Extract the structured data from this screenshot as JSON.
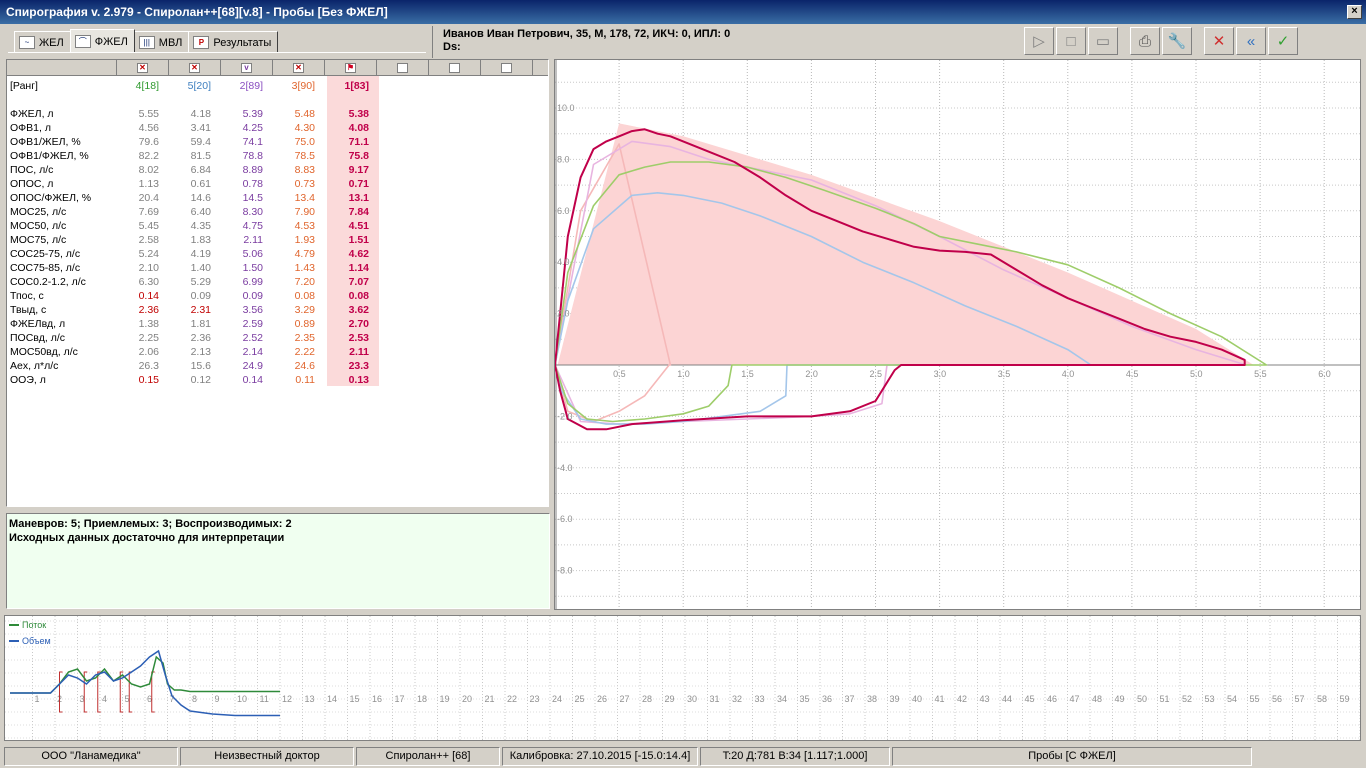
{
  "window": {
    "title": "Спирография v. 2.979 - Спиролан++[68][v.8] - Пробы [Без ФЖЕЛ]",
    "close": "×"
  },
  "tabs": [
    {
      "label": "ЖЕЛ",
      "icon": "vc-wave-icon"
    },
    {
      "label": "ФЖЕЛ",
      "icon": "fvc-curve-icon"
    },
    {
      "label": "МВЛ",
      "icon": "mvv-bars-icon"
    },
    {
      "label": "Результаты",
      "icon": "results-icon",
      "icon_text": "P"
    }
  ],
  "patient": {
    "line1": "Иванов Иван Петрович, 35, М, 178, 72, ИКЧ: 0, ИПЛ: 0",
    "line2": "Ds:"
  },
  "toolbar": {
    "buttons": [
      {
        "name": "play-icon",
        "glyph": "▷"
      },
      {
        "name": "stop-icon",
        "glyph": "□"
      },
      {
        "name": "minus-icon",
        "glyph": "▭"
      },
      {
        "name": "printer-icon",
        "glyph": "⎙"
      },
      {
        "name": "wrench-icon",
        "glyph": "🔧"
      },
      {
        "name": "delete-icon",
        "glyph": "✕"
      },
      {
        "name": "rewind-icon",
        "glyph": "«"
      },
      {
        "name": "accept-icon",
        "glyph": "✓"
      }
    ]
  },
  "table": {
    "rank_label": "[Ранг]",
    "columns": [
      {
        "rank": "4[18]",
        "color": "#2f9a2f"
      },
      {
        "rank": "5[20]",
        "color": "#3f7fbf"
      },
      {
        "rank": "2[89]",
        "color": "#8a4fc0"
      },
      {
        "rank": "3[90]",
        "color": "#e0652d"
      },
      {
        "rank": "1[83]",
        "color": "#c0004a"
      }
    ],
    "rows": [
      {
        "label": "ФЖЕЛ, л",
        "values": [
          "5.55",
          "4.18",
          "5.39",
          "5.48",
          "5.38"
        ]
      },
      {
        "label": "ОФВ1, л",
        "values": [
          "4.56",
          "3.41",
          "4.25",
          "4.30",
          "4.08"
        ]
      },
      {
        "label": "ОФВ1/ЖЕЛ, %",
        "values": [
          "79.6",
          "59.4",
          "74.1",
          "75.0",
          "71.1"
        ]
      },
      {
        "label": "ОФВ1/ФЖЕЛ, %",
        "values": [
          "82.2",
          "81.5",
          "78.8",
          "78.5",
          "75.8"
        ]
      },
      {
        "label": "ПОС, л/с",
        "values": [
          "8.02",
          "6.84",
          "8.89",
          "8.83",
          "9.17"
        ]
      },
      {
        "label": "ОПОС, л",
        "values": [
          "1.13",
          "0.61",
          "0.78",
          "0.73",
          "0.71"
        ]
      },
      {
        "label": "ОПОС/ФЖЕЛ, %",
        "values": [
          "20.4",
          "14.6",
          "14.5",
          "13.4",
          "13.1"
        ]
      },
      {
        "label": "МОС25, л/с",
        "values": [
          "7.69",
          "6.40",
          "8.30",
          "7.90",
          "7.84"
        ]
      },
      {
        "label": "МОС50, л/с",
        "values": [
          "5.45",
          "4.35",
          "4.75",
          "4.53",
          "4.51"
        ]
      },
      {
        "label": "МОС75, л/с",
        "values": [
          "2.58",
          "1.83",
          "2.11",
          "1.93",
          "1.51"
        ]
      },
      {
        "label": "СОС25-75, л/с",
        "values": [
          "5.24",
          "4.19",
          "5.06",
          "4.79",
          "4.62"
        ]
      },
      {
        "label": "СОС75-85, л/с",
        "values": [
          "2.10",
          "1.40",
          "1.50",
          "1.43",
          "1.14"
        ]
      },
      {
        "label": "СОС0.2-1.2, л/с",
        "values": [
          "6.30",
          "5.29",
          "6.99",
          "7.20",
          "7.07"
        ]
      },
      {
        "label": "Тпос, с",
        "values": [
          "0.14",
          "0.09",
          "0.09",
          "0.08",
          "0.08"
        ],
        "warn": [
          true,
          false,
          false,
          false,
          false
        ]
      },
      {
        "label": "Твыд, с",
        "values": [
          "2.36",
          "2.31",
          "3.56",
          "3.29",
          "3.62"
        ],
        "warn": [
          true,
          true,
          false,
          false,
          false
        ]
      },
      {
        "label": "ФЖЕЛвд, л",
        "values": [
          "1.38",
          "1.81",
          "2.59",
          "0.89",
          "2.70"
        ]
      },
      {
        "label": "ПОСвд, л/с",
        "values": [
          "2.25",
          "2.36",
          "2.52",
          "2.35",
          "2.53"
        ]
      },
      {
        "label": "МОС50вд, л/с",
        "values": [
          "2.06",
          "2.13",
          "2.14",
          "2.22",
          "2.11"
        ]
      },
      {
        "label": "Aex, л*л/с",
        "values": [
          "26.3",
          "15.6",
          "24.9",
          "24.6",
          "23.3"
        ]
      },
      {
        "label": "ООЭ, л",
        "values": [
          "0.15",
          "0.12",
          "0.14",
          "0.11",
          "0.13"
        ],
        "warn": [
          true,
          false,
          false,
          false,
          false
        ]
      }
    ]
  },
  "remarks": {
    "line1": "Маневров: 5; Приемлемых: 3; Воспроизводимых: 2",
    "line2": "Исходных данных достаточно для интерпретации"
  },
  "chart_data": [
    {
      "type": "line",
      "title": "",
      "xlabel": "",
      "ylabel": "",
      "xlim": [
        0,
        6.0
      ],
      "ylim": [
        -8.0,
        10.0
      ],
      "x_ticks": [
        "0.5",
        "1.0",
        "1.5",
        "2.0",
        "2.5",
        "3.0",
        "3.5",
        "4.0",
        "4.5",
        "5.0",
        "5.5",
        "6.0"
      ],
      "y_ticks": [
        "10.0",
        "8.0",
        "6.0",
        "4.0",
        "2.0",
        "-2.0",
        "-4.0",
        "-6.0",
        "-8.0"
      ],
      "predicted_area": {
        "color": "#fcd4d4",
        "x": [
          0.02,
          0.5,
          0.7,
          1.0,
          2.0,
          3.0,
          4.0,
          5.0,
          5.45
        ],
        "y": [
          0,
          9.4,
          9.2,
          8.9,
          7.4,
          5.6,
          3.6,
          1.4,
          0
        ]
      },
      "series": [
        {
          "color": "#c0004a",
          "x": [
            0,
            0.05,
            0.1,
            0.2,
            0.3,
            0.4,
            0.5,
            0.6,
            0.7,
            0.8,
            0.9,
            1.0,
            1.2,
            1.4,
            1.6,
            1.8,
            2.0,
            2.2,
            2.4,
            2.6,
            2.8,
            3.0,
            3.2,
            3.4,
            3.6,
            3.8,
            4.0,
            4.2,
            4.4,
            4.6,
            4.8,
            5.0,
            5.2,
            5.38,
            5.38,
            5.2,
            5.0,
            4.6,
            4.0,
            3.5,
            3.0,
            2.7,
            2.65,
            2.5,
            2.3,
            2.0,
            1.5,
            1.0,
            0.6,
            0.4,
            0.25,
            0.1,
            0.04,
            0
          ],
          "y": [
            0,
            2.5,
            5.0,
            7.3,
            8.4,
            8.7,
            8.9,
            9.1,
            9.17,
            9.0,
            8.9,
            8.7,
            8.3,
            7.9,
            7.3,
            6.6,
            6.0,
            5.6,
            5.2,
            4.9,
            4.6,
            4.45,
            4.4,
            4.3,
            3.7,
            3.1,
            2.6,
            2.2,
            1.8,
            1.4,
            1.1,
            0.9,
            0.6,
            0.2,
            0,
            0,
            0,
            0,
            0,
            0,
            0,
            0,
            -0.2,
            -1.4,
            -1.8,
            -2.0,
            -2.0,
            -2.15,
            -2.3,
            -2.5,
            -2.5,
            -2.1,
            -1.0,
            0
          ]
        },
        {
          "color": "#9ecd6a",
          "x": [
            0,
            0.1,
            0.3,
            0.5,
            0.7,
            0.9,
            1.2,
            1.5,
            1.8,
            2.1,
            2.5,
            2.8,
            3.0,
            3.3,
            3.6,
            4.0,
            4.4,
            4.8,
            5.2,
            5.55,
            5.55,
            1.38,
            1.35,
            1.2,
            1.0,
            0.7,
            0.45,
            0.25,
            0.1,
            0
          ],
          "y": [
            0,
            3.6,
            6.2,
            7.4,
            7.7,
            7.9,
            7.9,
            7.7,
            7.3,
            6.8,
            6.1,
            5.5,
            5.0,
            4.7,
            4.4,
            3.9,
            3.0,
            2.0,
            1.1,
            0,
            0,
            0,
            -0.8,
            -1.6,
            -1.9,
            -2.1,
            -2.2,
            -2.1,
            -1.5,
            0
          ]
        },
        {
          "color": "#a4c6ea",
          "x": [
            0,
            0.1,
            0.3,
            0.6,
            0.8,
            1.0,
            1.3,
            1.6,
            2.0,
            2.4,
            2.8,
            3.2,
            3.6,
            4.0,
            4.18,
            4.18,
            1.81,
            1.8,
            1.6,
            1.3,
            1.0,
            0.7,
            0.4,
            0.2,
            0.05,
            0
          ],
          "y": [
            0,
            2.5,
            5.3,
            6.6,
            6.7,
            6.6,
            6.3,
            5.8,
            5.0,
            4.0,
            3.2,
            2.3,
            1.5,
            0.6,
            0,
            0,
            0,
            -1.2,
            -1.8,
            -2.0,
            -2.2,
            -2.3,
            -2.3,
            -2.1,
            -1.0,
            0
          ]
        },
        {
          "color": "#e8b4e0",
          "x": [
            0,
            0.3,
            0.6,
            0.9,
            1.2,
            1.6,
            2.0,
            2.5,
            3.0,
            3.5,
            4.0,
            4.5,
            5.0,
            5.39,
            5.39,
            2.59,
            2.55,
            2.3,
            2.0,
            1.5,
            1.0,
            0.5,
            0.2,
            0
          ],
          "y": [
            0,
            7.8,
            8.7,
            8.5,
            8.0,
            7.6,
            7.2,
            6.2,
            5.0,
            3.7,
            2.6,
            1.5,
            0.6,
            0,
            0,
            0,
            -1.5,
            -1.9,
            -2.0,
            -2.1,
            -2.2,
            -2.3,
            -2.2,
            0
          ]
        },
        {
          "color": "#f5b8b8",
          "x": [
            0,
            0.2,
            0.5,
            0.9,
            0.89,
            0.7,
            0.5,
            0.3,
            0.1,
            0
          ],
          "y": [
            0,
            6.0,
            8.6,
            0,
            0,
            -1.2,
            -1.8,
            -2.2,
            -1.8,
            0
          ]
        }
      ]
    },
    {
      "type": "line",
      "title": "",
      "xlabel": "",
      "ylabel": "",
      "xlim": [
        0,
        60
      ],
      "x_ticks": [
        "1",
        "2",
        "3",
        "4",
        "5",
        "6",
        "7",
        "8",
        "9",
        "10",
        "11",
        "12",
        "13",
        "14",
        "15",
        "16",
        "17",
        "18",
        "19",
        "20",
        "21",
        "22",
        "23",
        "24",
        "25",
        "26",
        "27",
        "28",
        "29",
        "30",
        "31",
        "32",
        "33",
        "34",
        "35",
        "36",
        "37",
        "38",
        "39",
        "40",
        "41",
        "42",
        "43",
        "44",
        "45",
        "46",
        "47",
        "48",
        "49",
        "50",
        "51",
        "52",
        "53",
        "54",
        "55",
        "56",
        "57",
        "58",
        "59"
      ],
      "legend": [
        {
          "name": "Поток",
          "color": "#2f8a3a"
        },
        {
          "name": "Объем",
          "color": "#2c5fb5"
        }
      ],
      "marker_color": "#c03030",
      "markers": [
        2.2,
        3.3,
        3.9,
        4.9,
        5.3,
        6.3
      ],
      "series": [
        {
          "name": "Поток",
          "color": "#2f8a3a",
          "x": [
            0,
            1,
            1.8,
            2.2,
            2.6,
            3.0,
            3.4,
            3.8,
            4.2,
            4.6,
            5.0,
            5.4,
            5.8,
            6.2,
            6.5,
            6.8,
            7.0,
            7.3,
            7.6,
            8,
            9,
            10,
            11,
            12
          ],
          "y": [
            0,
            0,
            0,
            0.3,
            0.7,
            0.8,
            0.4,
            0.5,
            0.8,
            0.4,
            0.6,
            0.3,
            0.2,
            0.3,
            1.2,
            1.0,
            0.3,
            0.1,
            0.1,
            0.05,
            0.05,
            0.05,
            0.05,
            0.05
          ]
        },
        {
          "name": "Объем",
          "color": "#2c5fb5",
          "x": [
            0,
            1.8,
            2.2,
            2.6,
            3.0,
            3.4,
            3.8,
            4.2,
            4.6,
            5.0,
            5.4,
            5.8,
            6.2,
            6.6,
            6.9,
            7.2,
            7.6,
            8,
            9,
            10,
            11,
            12
          ],
          "y": [
            0,
            0,
            0.3,
            0.6,
            0.5,
            0.3,
            0.6,
            0.7,
            0.4,
            0.5,
            0.7,
            0.9,
            1.2,
            1.4,
            0.6,
            -0.1,
            -0.4,
            -0.6,
            -0.7,
            -0.75,
            -0.75,
            -0.75
          ]
        }
      ]
    }
  ],
  "status": [
    "ООО \"Ланамедика\"",
    "Неизвестный доктор",
    "Спиролан++ [68]",
    "Калибровка: 27.10.2015 [-15.0:14.4]",
    "T:20 Д:781 В:34 [1.117;1.000]",
    "Пробы [С ФЖЕЛ]"
  ]
}
